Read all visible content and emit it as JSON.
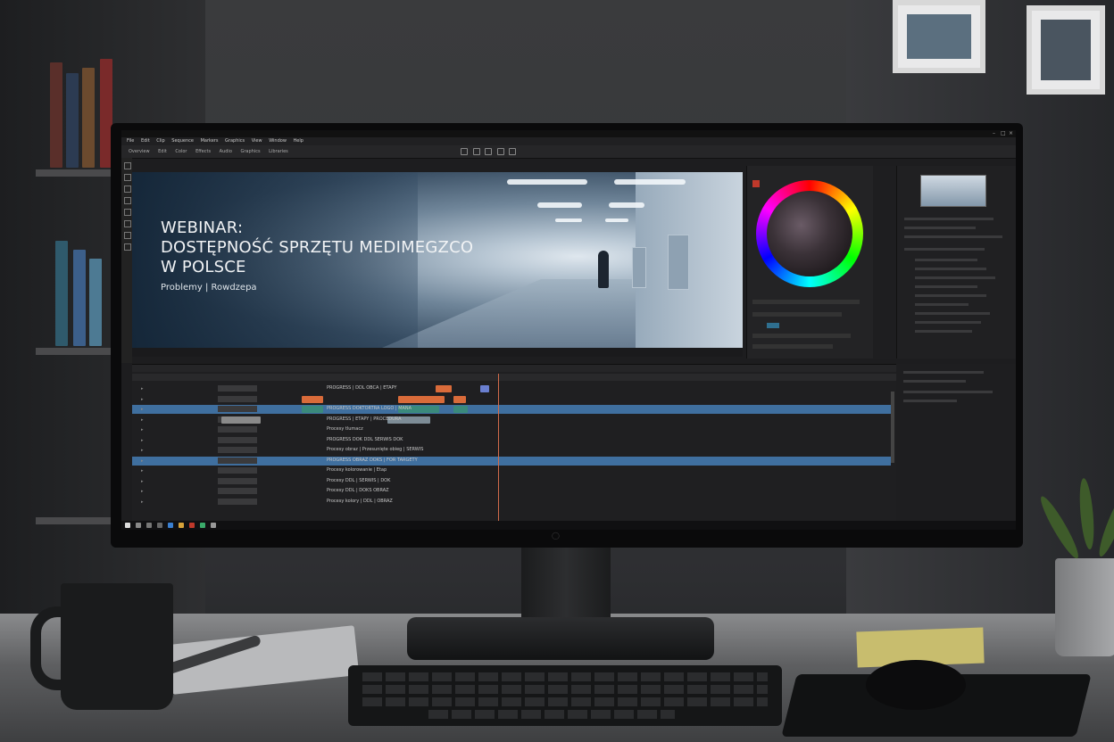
{
  "editor": {
    "menu": [
      "File",
      "Edit",
      "Clip",
      "Sequence",
      "Markers",
      "Graphics",
      "View",
      "Window",
      "Help"
    ],
    "toolbar": [
      "Overview",
      "Edit",
      "Color",
      "Effects",
      "Audio",
      "Graphics",
      "Libraries"
    ]
  },
  "preview": {
    "title_line1": "WEBINAR:",
    "title_line2": "DOSTĘPNOŚĆ SPRZĘTU MEDIMEGZCO",
    "title_line3": "W POLSCE",
    "subtitle": "Problemy | Rowdzepa"
  },
  "timeline": {
    "tracks": [
      {
        "label": "PROGRESS | DDL OBCA | ETAPY",
        "selected": false
      },
      {
        "label": "",
        "selected": false
      },
      {
        "label": "PROGRESS DOKTORTRA LOGO | MANA",
        "selected": true
      },
      {
        "label": "PROGRESS | ETAPY | PROCEDURA",
        "selected": false
      },
      {
        "label": "Procesy tlumacz",
        "selected": false
      },
      {
        "label": "PROGRESS DOK DDL SERWIS DOK",
        "selected": false
      },
      {
        "label": "Procesy obraz | Przesunięte obieg | SERWIS",
        "selected": false
      },
      {
        "label": "PROGRESS OBRAZ DOKS | FOR TARGETY",
        "selected": true
      },
      {
        "label": "Procesy kolorowanie | Etap",
        "selected": false
      },
      {
        "label": "Procesy DDL | SERWIS | DOK",
        "selected": false
      },
      {
        "label": "Procesy DDL | DOKS OBRAZ",
        "selected": false
      },
      {
        "label": "Procesy kolory | DDL | OBRAZ",
        "selected": false
      }
    ]
  },
  "colors": {
    "selected_track": "#3f6f9f",
    "playhead": "#d26b4a",
    "clip_orange": "#d96b3a",
    "clip_teal": "#3a8a7c"
  }
}
